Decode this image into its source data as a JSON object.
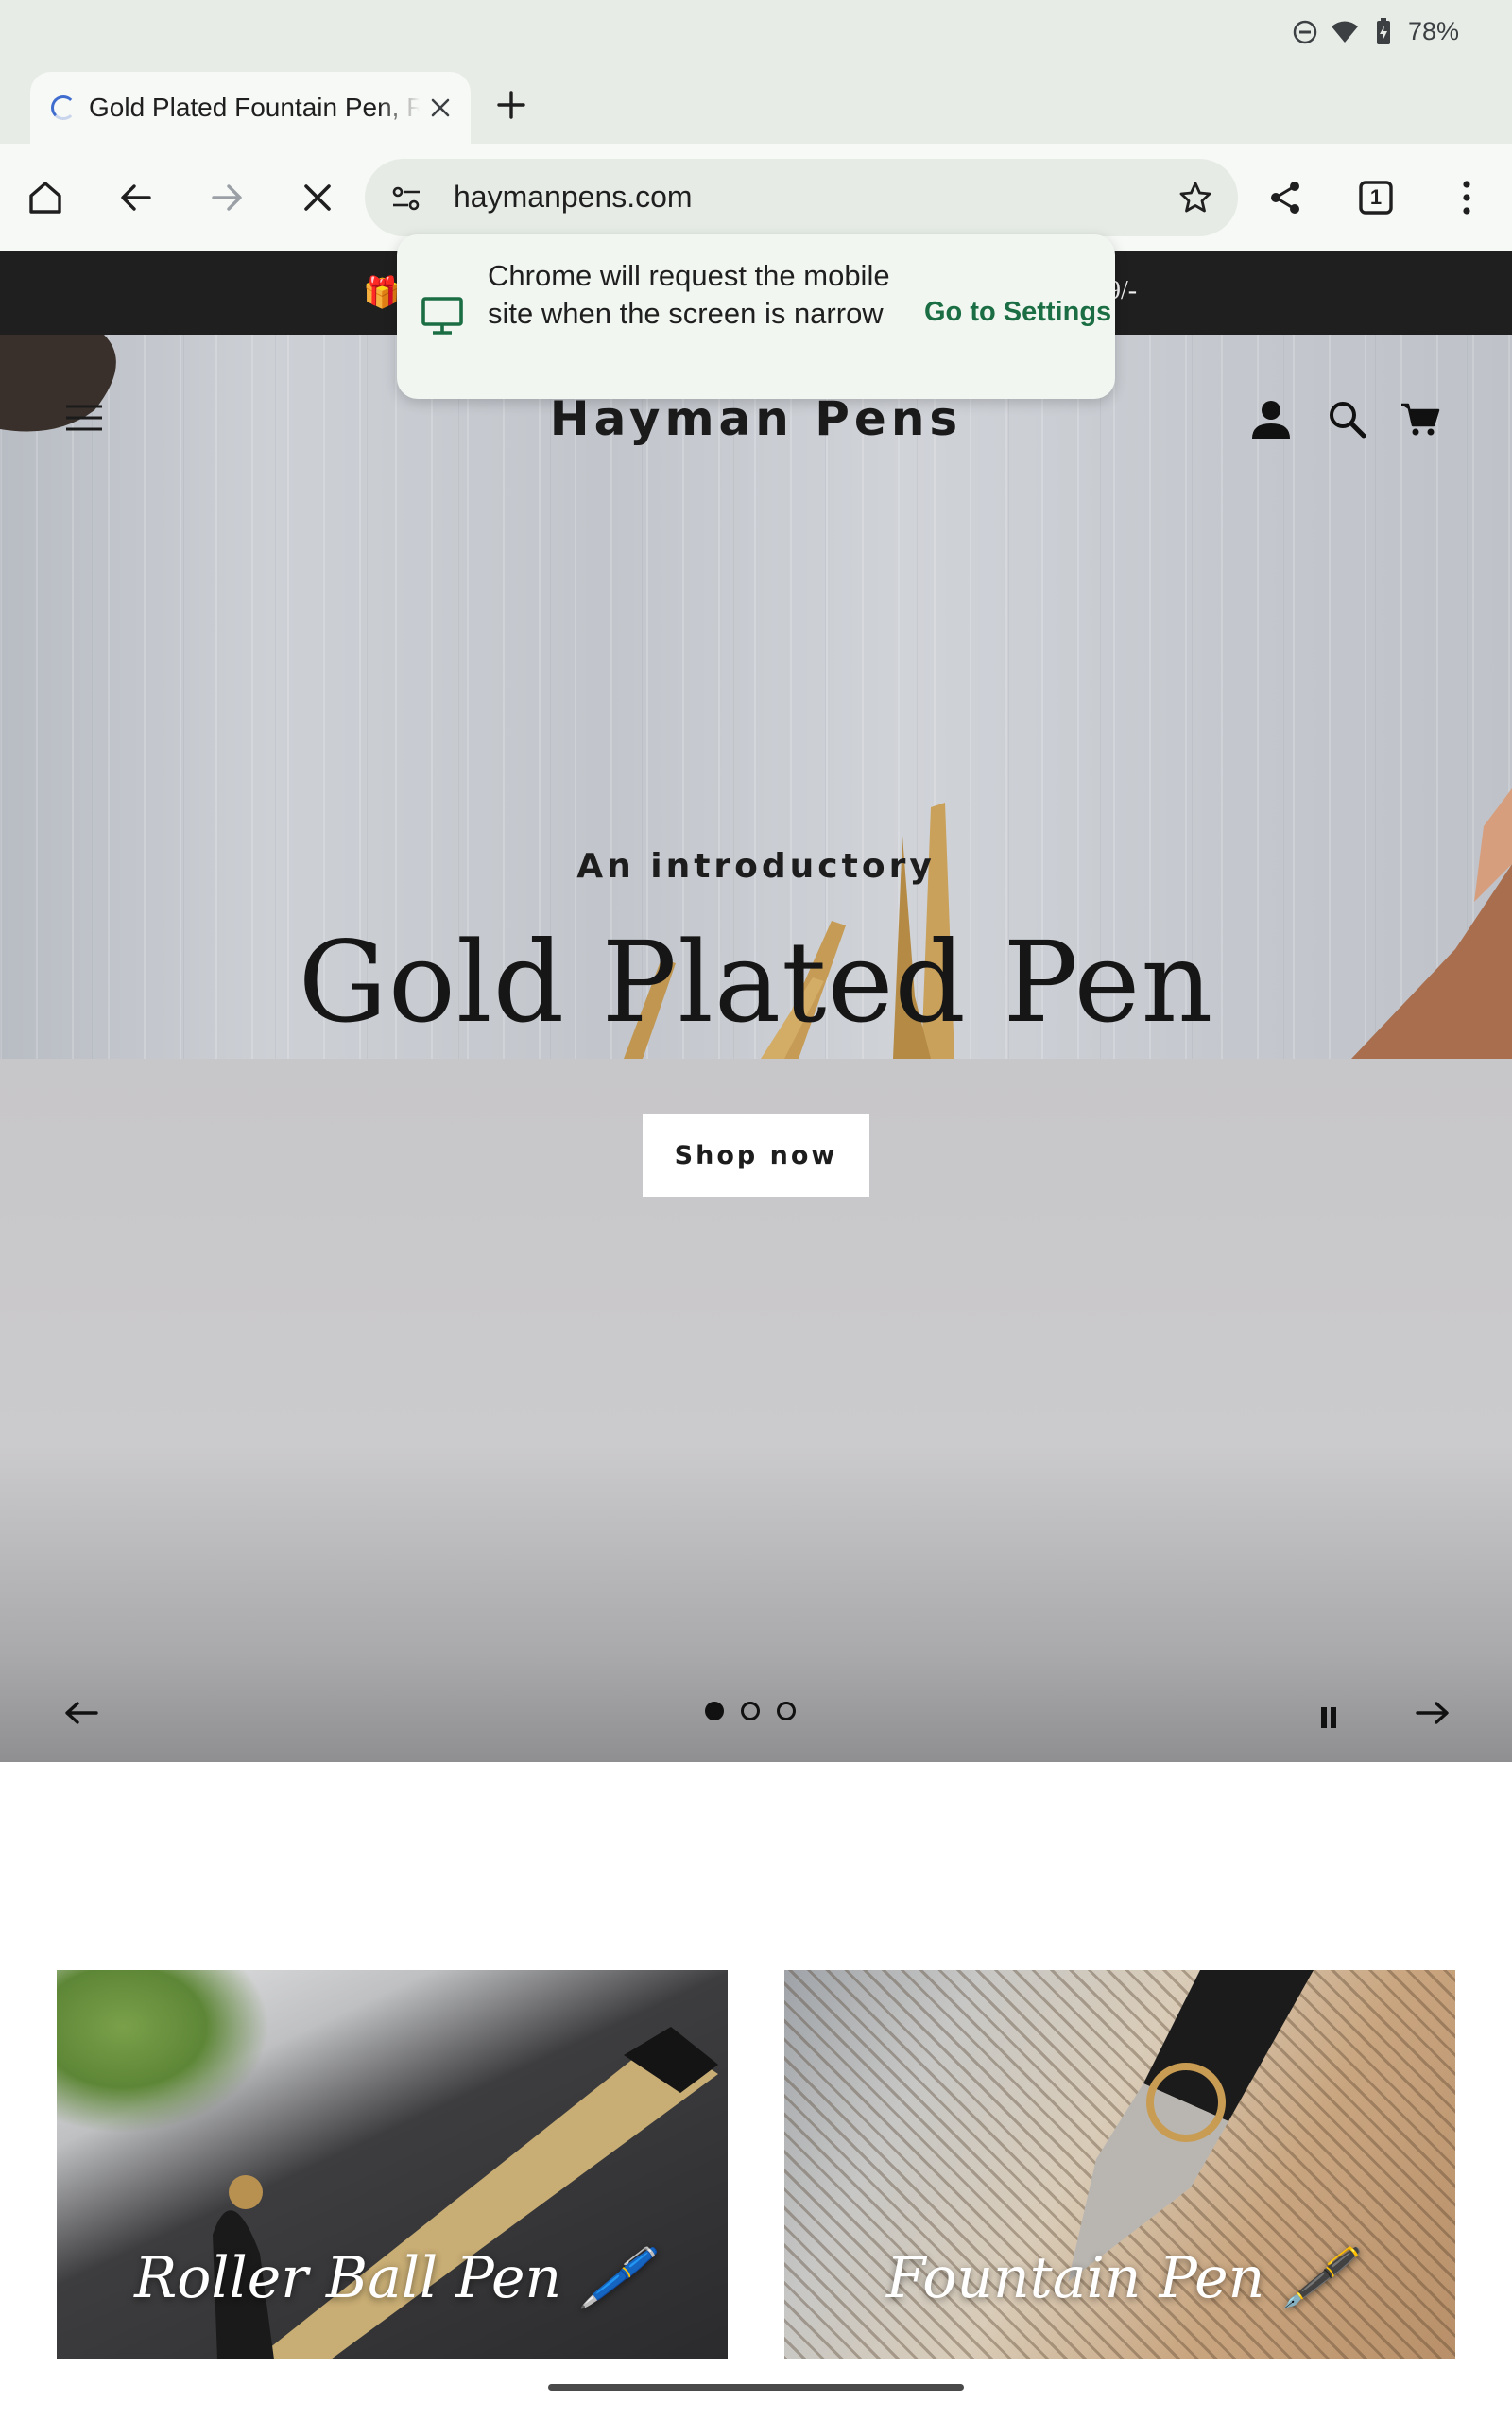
{
  "status_bar": {
    "battery": "78%",
    "icons": [
      "dnd-icon",
      "wifi-icon",
      "battery-charging-icon"
    ]
  },
  "browser": {
    "tab_title": "Gold Plated Fountain Pen, R",
    "url": "haymanpens.com",
    "tab_count": "1",
    "loading": true,
    "accent_color": "#1b6e43"
  },
  "toast": {
    "message": "Chrome will request the mobile site when the screen is narrow",
    "action": "Go to Settings"
  },
  "page": {
    "announcement_gift": "🎁",
    "announcement_visible_text": "9/-",
    "brand": "Hayman Pens",
    "hero": {
      "kicker": "An introductory",
      "title": "Gold Plated Pen",
      "cta": "Shop now",
      "slide_count": 3,
      "active_slide": 1
    },
    "collections": [
      {
        "label": "Roller Ball Pen 🖊️"
      },
      {
        "label": "Fountain Pen 🖋️"
      }
    ]
  }
}
